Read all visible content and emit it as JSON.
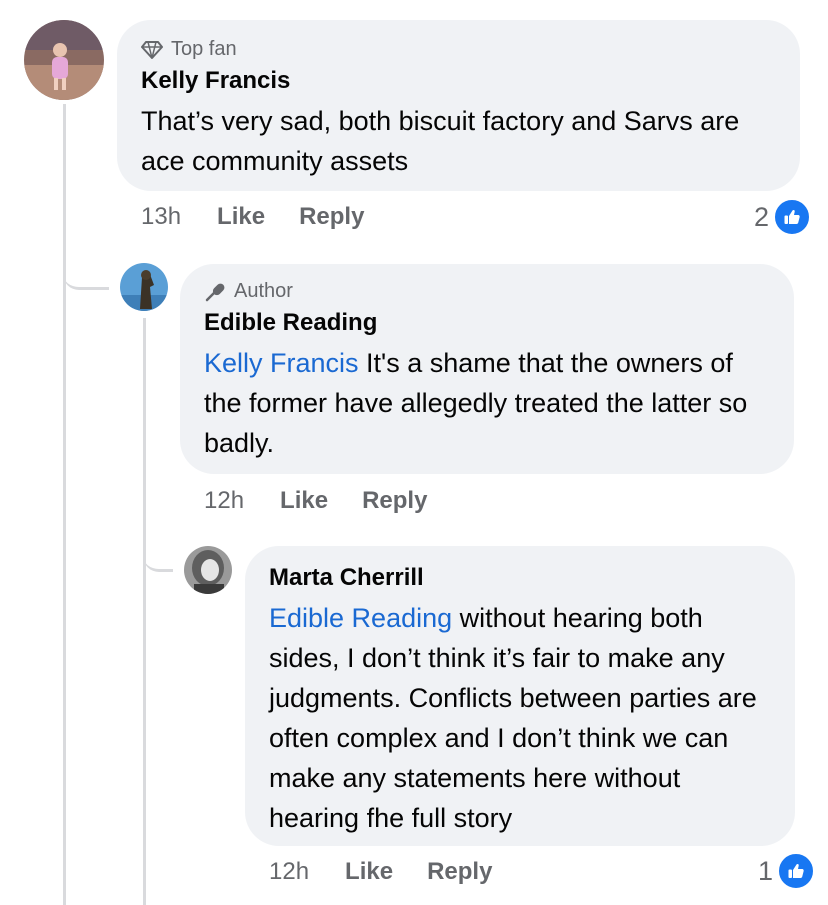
{
  "comments": [
    {
      "badge": "Top fan",
      "author": "Kelly Francis",
      "text": "That’s very sad, both biscuit factory and Sarvs are ace community assets",
      "time": "13h",
      "like_label": "Like",
      "reply_label": "Reply",
      "reaction_count": "2",
      "reaction_icon": "thumbs-up"
    },
    {
      "badge": "Author",
      "author": "Edible Reading",
      "mention": "Kelly Francis",
      "text": " It's a shame that the owners of the former have allegedly treated the latter so badly.",
      "time": "12h",
      "like_label": "Like",
      "reply_label": "Reply"
    },
    {
      "author": "Marta Cherrill",
      "mention": "Edible Reading",
      "text": " without hearing both sides, I don’t think it’s fair to make any judgments. Conflicts between parties are often complex and I don’t think we can make any statements here without hearing fhe full story",
      "time": "12h",
      "like_label": "Like",
      "reply_label": "Reply",
      "reaction_count": "1",
      "reaction_icon": "thumbs-up"
    }
  ],
  "colors": {
    "bubble": "#f0f2f5",
    "mention": "#1a69d2",
    "secondary_text": "#65676b",
    "like_blue": "#1877f2",
    "thread_line": "#d9dadd"
  }
}
